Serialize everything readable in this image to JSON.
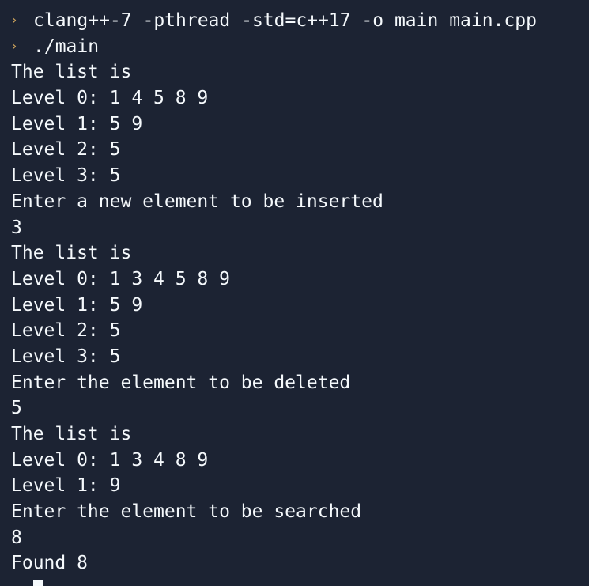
{
  "theme": {
    "background": "#1c2333",
    "foreground": "#f5f9fc",
    "prompt_color": "#c9a05b"
  },
  "prompt_symbol": "›",
  "commands": [
    "clang++-7 -pthread -std=c++17 -o main main.cpp",
    "./main"
  ],
  "output": [
    "The list is",
    "Level 0: 1 4 5 8 9",
    "Level 1: 5 9",
    "Level 2: 5",
    "Level 3: 5",
    "Enter a new element to be inserted",
    "3",
    "The list is",
    "Level 0: 1 3 4 5 8 9",
    "Level 1: 5 9",
    "Level 2: 5",
    "Level 3: 5",
    "Enter the element to be deleted",
    "5",
    "The list is",
    "Level 0: 1 3 4 8 9",
    "Level 1: 9",
    "Enter the element to be searched",
    "8",
    "Found 8"
  ]
}
